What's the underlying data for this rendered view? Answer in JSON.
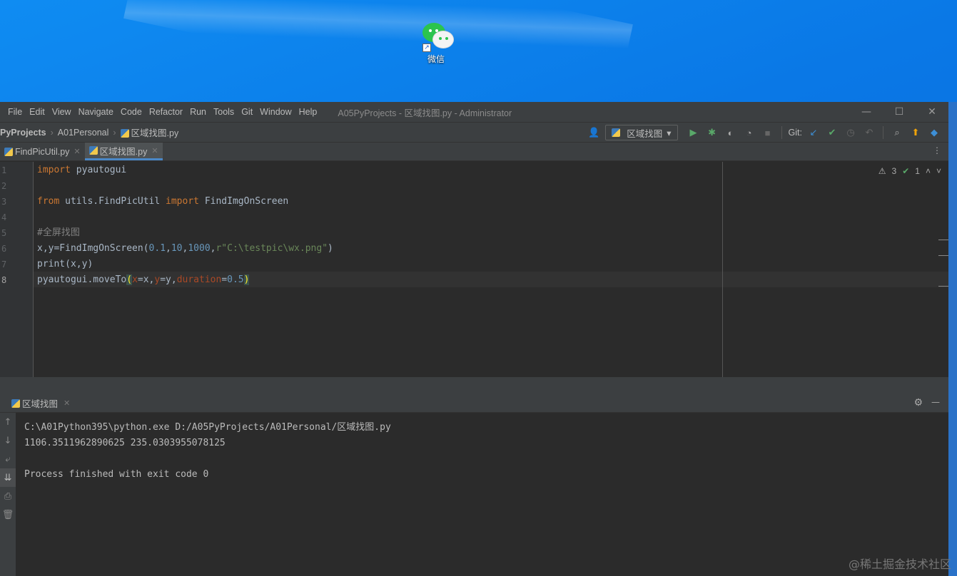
{
  "desktop": {
    "icon_label": "微信",
    "shortcut_glyph": "↗",
    "colors": {
      "wechat_green": "#2bc44e"
    }
  },
  "menubar": {
    "items": [
      "File",
      "Edit",
      "View",
      "Navigate",
      "Code",
      "Refactor",
      "Run",
      "Tools",
      "Git",
      "Window",
      "Help"
    ],
    "title": "A05PyProjects - 区域找图.py - Administrator",
    "minimize": "—",
    "maximize": "☐",
    "close": "✕"
  },
  "navbar": {
    "crumbs": [
      "PyProjects",
      "A01Personal",
      "区域找图.py"
    ],
    "run_config": "区域找图",
    "git_label": "Git:",
    "icons": [
      "user-icon",
      "run-icon",
      "debug-icon",
      "coverage-icon",
      "profile-icon",
      "stop-icon",
      "git-update-icon",
      "git-commit-icon",
      "history-icon",
      "rollback-icon",
      "search-icon",
      "update-icon",
      "plugin-icon"
    ]
  },
  "tabs": [
    {
      "label": "FindPicUtil.py",
      "active": false
    },
    {
      "label": "区域找图.py",
      "active": true
    }
  ],
  "editor": {
    "line_numbers": [
      "1",
      "2",
      "3",
      "4",
      "5",
      "6",
      "7",
      "8"
    ],
    "inspections": {
      "warnings": "3",
      "ok": "1"
    }
  },
  "run": {
    "tab_label": "区域找图",
    "output": [
      "C:\\A01Python395\\python.exe D:/A05PyProjects/A01Personal/区域找图.py",
      "1106.3511962890625 235.0303955078125",
      "",
      "Process finished with exit code 0"
    ]
  },
  "watermark": "@稀土掘金技术社区"
}
